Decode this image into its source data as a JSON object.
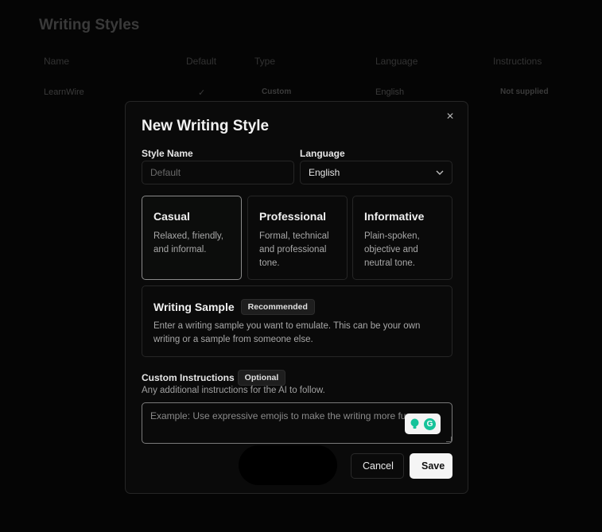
{
  "background": {
    "title": "Writing Styles",
    "columns": [
      "Name",
      "Default",
      "Type",
      "Language",
      "Instructions"
    ],
    "row": {
      "name": "LearnWire",
      "default": "✓",
      "type": "Custom",
      "language": "English",
      "instructions": "Not supplied"
    }
  },
  "modal": {
    "title": "New Writing Style",
    "close_icon": "×",
    "style_name": {
      "label": "Style Name",
      "placeholder": "Default"
    },
    "language": {
      "label": "Language",
      "value": "English"
    },
    "styles": [
      {
        "title": "Casual",
        "desc": "Relaxed, friendly, and informal.",
        "selected": true
      },
      {
        "title": "Professional",
        "desc": "Formal, technical and professional tone.",
        "selected": false
      },
      {
        "title": "Informative",
        "desc": "Plain-spoken, objective and neutral tone.",
        "selected": false
      }
    ],
    "writing_sample": {
      "title": "Writing Sample",
      "badge": "Recommended",
      "desc": "Enter a writing sample you want to emulate. This can be your own writing or a sample from someone else."
    },
    "custom_instructions": {
      "label": "Custom Instructions",
      "badge": "Optional",
      "help": "Any additional instructions for the AI to follow.",
      "placeholder": "Example: Use expressive emojis to make the writing more fun..."
    },
    "buttons": {
      "cancel": "Cancel",
      "save": "Save"
    }
  }
}
